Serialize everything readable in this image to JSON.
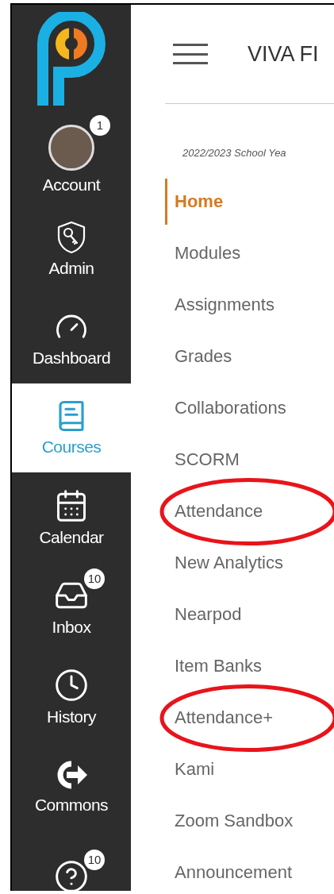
{
  "sidebar": {
    "items": [
      {
        "kind": "account",
        "label": "Account",
        "badge": "1",
        "selected": false
      },
      {
        "kind": "admin",
        "label": "Admin",
        "selected": false
      },
      {
        "kind": "dashboard",
        "label": "Dashboard",
        "selected": false
      },
      {
        "kind": "courses",
        "label": "Courses",
        "selected": true
      },
      {
        "kind": "calendar",
        "label": "Calendar",
        "selected": false
      },
      {
        "kind": "inbox",
        "label": "Inbox",
        "badge": "10",
        "selected": false
      },
      {
        "kind": "history",
        "label": "History",
        "selected": false
      },
      {
        "kind": "commons",
        "label": "Commons",
        "selected": false
      },
      {
        "kind": "help",
        "badge": "10",
        "selected": false
      }
    ]
  },
  "header": {
    "title": "VIVA FI"
  },
  "term": "2022/2023 School Yea",
  "course_nav": [
    {
      "label": "Home",
      "selected": true,
      "circled": false
    },
    {
      "label": "Modules",
      "selected": false,
      "circled": false
    },
    {
      "label": "Assignments",
      "selected": false,
      "circled": false
    },
    {
      "label": "Grades",
      "selected": false,
      "circled": false
    },
    {
      "label": "Collaborations",
      "selected": false,
      "circled": false
    },
    {
      "label": "SCORM",
      "selected": false,
      "circled": false
    },
    {
      "label": "Attendance",
      "selected": false,
      "circled": true
    },
    {
      "label": "New Analytics",
      "selected": false,
      "circled": false
    },
    {
      "label": "Nearpod",
      "selected": false,
      "circled": false
    },
    {
      "label": "Item Banks",
      "selected": false,
      "circled": false
    },
    {
      "label": "Attendance+",
      "selected": false,
      "circled": true
    },
    {
      "label": "Kami",
      "selected": false,
      "circled": false
    },
    {
      "label": "Zoom Sandbox",
      "selected": false,
      "circled": false
    },
    {
      "label": "Announcement",
      "selected": false,
      "circled": false
    }
  ]
}
